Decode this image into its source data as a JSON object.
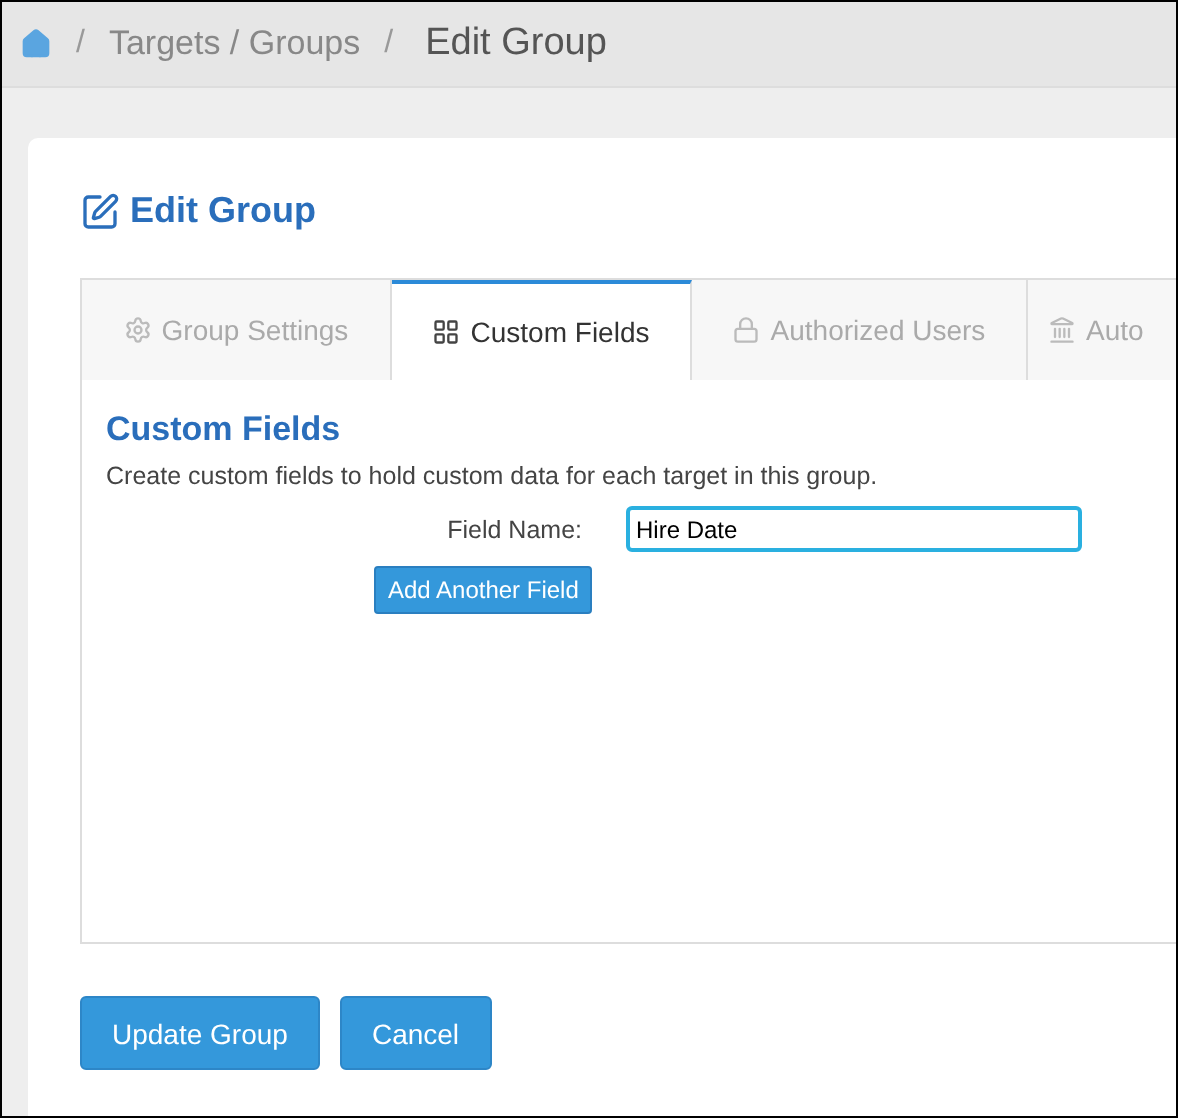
{
  "breadcrumb": {
    "items": [
      {
        "label": "Targets / Groups"
      }
    ],
    "current": "Edit Group",
    "separator": "/"
  },
  "card": {
    "title": "Edit Group"
  },
  "tabs": [
    {
      "label": "Group Settings",
      "selected": false,
      "kind": "gear"
    },
    {
      "label": "Custom Fields",
      "selected": true,
      "kind": "table"
    },
    {
      "label": "Authorized Users",
      "selected": false,
      "kind": "lock"
    },
    {
      "label": "Auto",
      "selected": false,
      "kind": "building"
    }
  ],
  "panel": {
    "heading": "Custom Fields",
    "description": "Create custom fields to hold custom data for each target in this group.",
    "fields": [
      {
        "label": "Field Name:",
        "value": "Hire Date",
        "focused": true
      }
    ],
    "add_button": "Add Another Field"
  },
  "buttons": [
    "Update Group",
    "Cancel"
  ]
}
